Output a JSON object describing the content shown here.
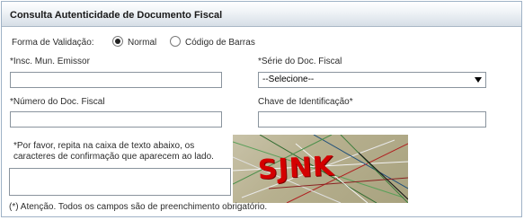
{
  "header": {
    "title": "Consulta Autenticidade de Documento Fiscal"
  },
  "validation": {
    "label": "Forma de Validação:",
    "options": [
      {
        "label": "Normal",
        "checked": true
      },
      {
        "label": "Código de Barras",
        "checked": false
      }
    ]
  },
  "fields": {
    "insc_label": "*Insc. Mun. Emissor",
    "insc_value": "",
    "serie_label": "*Série do Doc. Fiscal",
    "serie_selected": "--Selecione--",
    "numero_label": "*Número do Doc. Fiscal",
    "numero_value": "",
    "chave_label": "Chave de Identificação*",
    "chave_value": ""
  },
  "captcha": {
    "note": "*Por favor, repita na caixa de texto abaixo, os caracteres de confirmação que aparecem ao lado.",
    "input_value": "",
    "image_text": "SJNK"
  },
  "footer": {
    "notice": "(*) Atenção. Todos os campos são de preenchimento obrigatório."
  }
}
